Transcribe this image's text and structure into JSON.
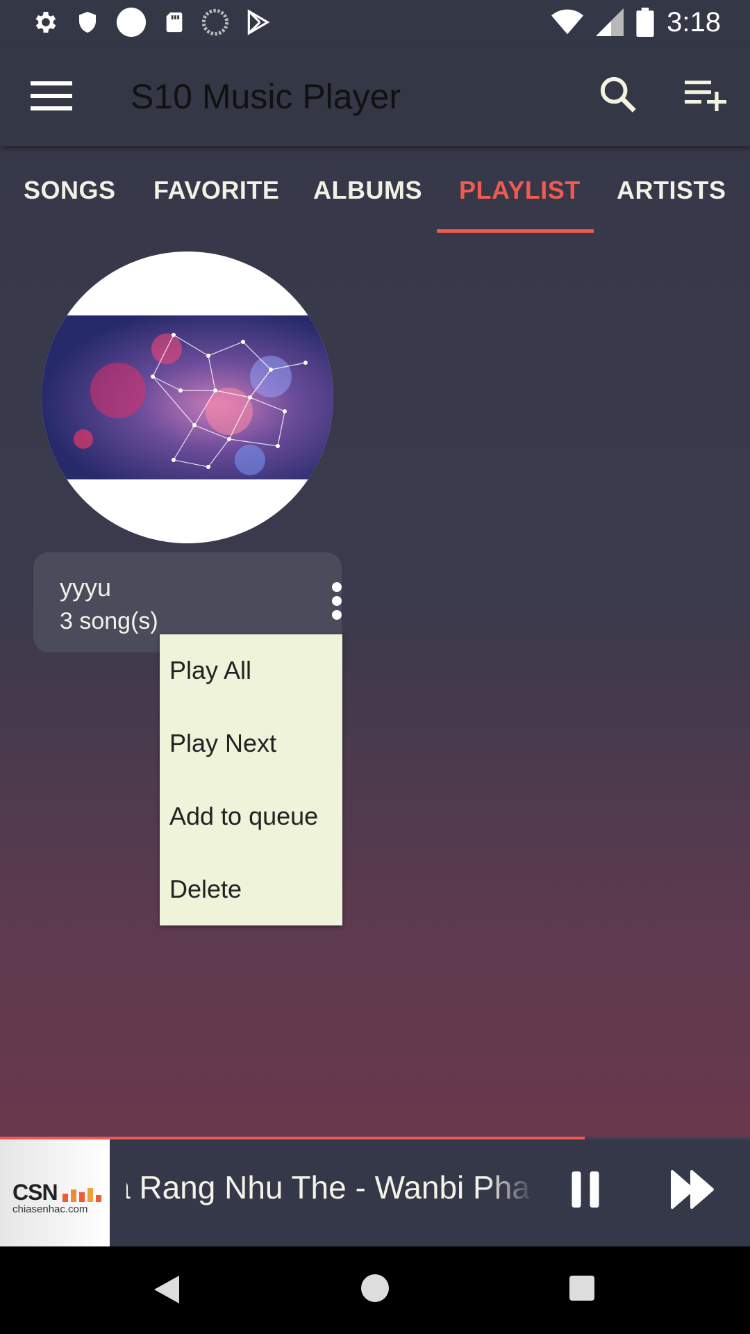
{
  "status_bar": {
    "time": "3:18",
    "icons_left": [
      "settings-icon",
      "shield-icon",
      "circle-icon",
      "sd-card-icon",
      "sync-icon",
      "play-store-icon"
    ],
    "icons_right": [
      "wifi-icon",
      "signal-icon",
      "battery-icon"
    ]
  },
  "toolbar": {
    "title": "S10 Music Player",
    "icons": [
      "menu-icon",
      "search-icon",
      "playlist-add-icon"
    ]
  },
  "tabs": {
    "items": [
      "SONGS",
      "FAVORITE",
      "ALBUMS",
      "PLAYLIST",
      "ARTISTS"
    ],
    "active": "PLAYLIST"
  },
  "playlist": {
    "name": "yyyu",
    "count": "3 song(s)"
  },
  "popup_menu": {
    "items": [
      "Play All",
      "Play Next",
      "Add to queue",
      "Delete"
    ]
  },
  "mini_player": {
    "thumb_logo": "CSN",
    "thumb_sub": "chiasenhac.com",
    "title": "a Rang Nhu The - Wanbi Phan",
    "progress": 0.78,
    "controls": [
      "pause-icon",
      "fast-forward-icon"
    ]
  },
  "nav_bar": {
    "icons": [
      "back-icon",
      "home-icon",
      "recents-icon"
    ]
  },
  "colors": {
    "accent": "#f05a50",
    "bar_bg": "#343746",
    "popup_bg": "#eef3d9"
  }
}
